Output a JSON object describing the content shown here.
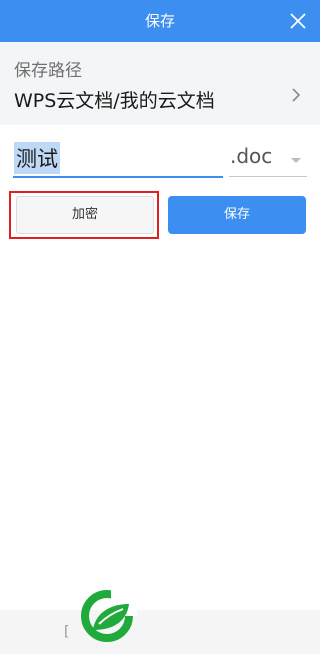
{
  "header": {
    "title": "保存",
    "close_icon": "close-icon"
  },
  "save_path": {
    "label": "保存路径",
    "value": "WPS云文档/我的云文档",
    "chevron_icon": "chevron-right-icon"
  },
  "filename": {
    "value": "测试",
    "extension": ".doc",
    "dropdown_icon": "caret-down-icon"
  },
  "buttons": {
    "encrypt_label": "加密",
    "save_label": "保存"
  },
  "footer": {
    "partial_text": "["
  },
  "colors": {
    "accent": "#3c8ff0",
    "highlight_frame": "#e02020",
    "selection": "#bed9f6",
    "watermark_green": "#1faa3b"
  }
}
